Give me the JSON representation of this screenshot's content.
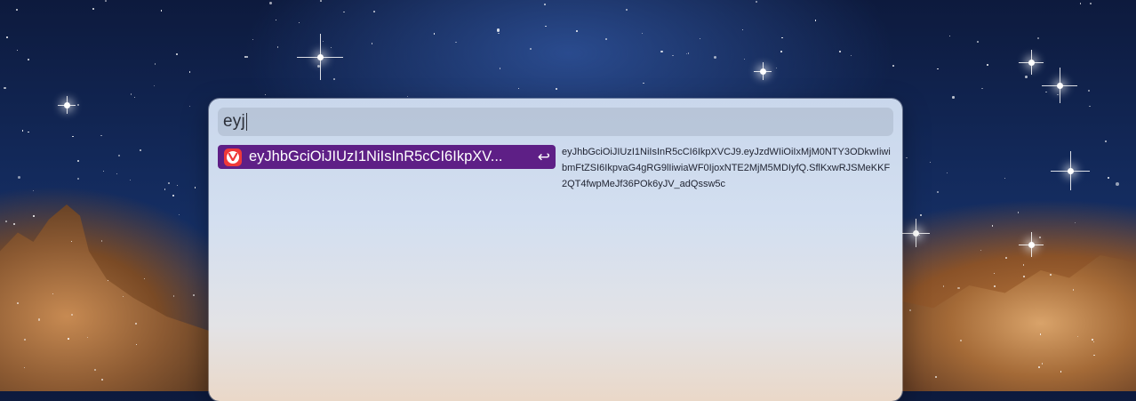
{
  "search": {
    "query": "eyj"
  },
  "results": [
    {
      "app_icon": "vivaldi-icon",
      "label": "eyJhbGciOiJIUzI1NiIsInR5cCI6IkpXV...",
      "action_icon": "return-icon",
      "action_glyph": "↩",
      "highlight_color": "#5e1f86"
    }
  ],
  "preview": {
    "text": "eyJhbGciOiJIUzI1NiIsInR5cCI6IkpXVCJ9.eyJzdWIiOiIxMjM0NTY3ODkwIiwibmFtZSI6IkpvaG4gRG9lIiwiaWF0IjoxNTE2MjM5MDIyfQ.SflKxwRJSMeKKF2QT4fwpMeJf36POk6yJV_adQssw5c"
  }
}
